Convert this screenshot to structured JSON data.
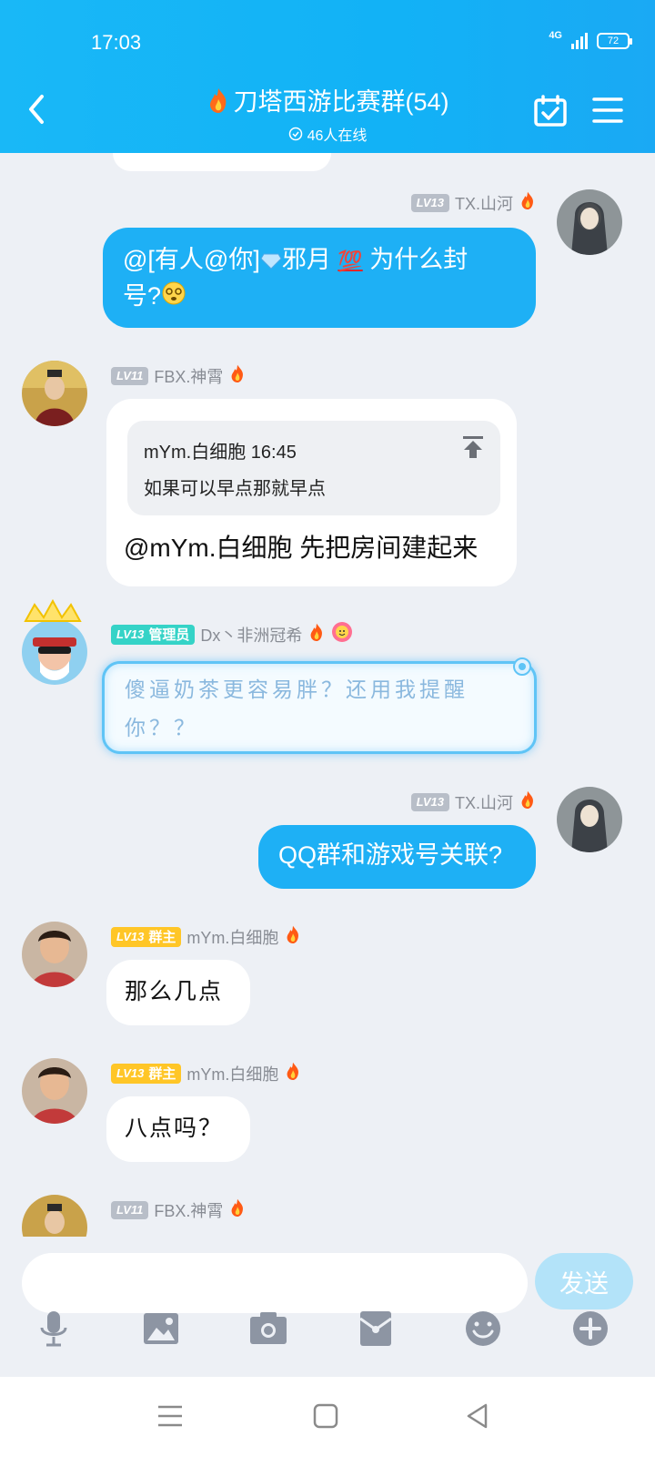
{
  "status": {
    "time": "17:03",
    "network": "4G",
    "battery": "72"
  },
  "header": {
    "title": "刀塔西游比赛群(54)",
    "online": "46人在线"
  },
  "messages": [
    {
      "id": "m1",
      "level": "LV13",
      "sender": "TX.山河",
      "parts": [
        "@[有人@你]",
        "邪月 ",
        " 为什么封",
        "号?"
      ]
    },
    {
      "id": "m2",
      "level": "LV11",
      "sender": "FBX.神霄",
      "quote": {
        "author": "mYm.白细胞",
        "time": "16:45",
        "text": "如果可以早点那就早点"
      },
      "text": "@mYm.白细胞 先把房间建起来"
    },
    {
      "id": "m3",
      "level": "LV13",
      "role": "管理员",
      "sender": "Dx丶非洲冠希",
      "text1": "傻逼奶茶更容易胖？还用我提醒",
      "text2": "你？？"
    },
    {
      "id": "m4",
      "level": "LV13",
      "sender": "TX.山河",
      "text": "QQ群和游戏号关联?"
    },
    {
      "id": "m5",
      "level": "LV13",
      "role": "群主",
      "sender": "mYm.白细胞",
      "text": "那么几点"
    },
    {
      "id": "m6",
      "level": "LV13",
      "role": "群主",
      "sender": "mYm.白细胞",
      "text": "八点吗？"
    },
    {
      "id": "m7",
      "level": "LV11",
      "sender": "FBX.神霄"
    }
  ],
  "input": {
    "placeholder": "",
    "send_label": "发送"
  },
  "toolbar": [
    "mic-icon",
    "image-icon",
    "camera-icon",
    "red-packet-icon",
    "emoji-icon",
    "plus-icon"
  ],
  "colors": {
    "header": "#12b2f6",
    "bubble_blue": "#1eb0f5",
    "owner_badge": "#ffc627",
    "admin_badge": "#35d3c7"
  }
}
